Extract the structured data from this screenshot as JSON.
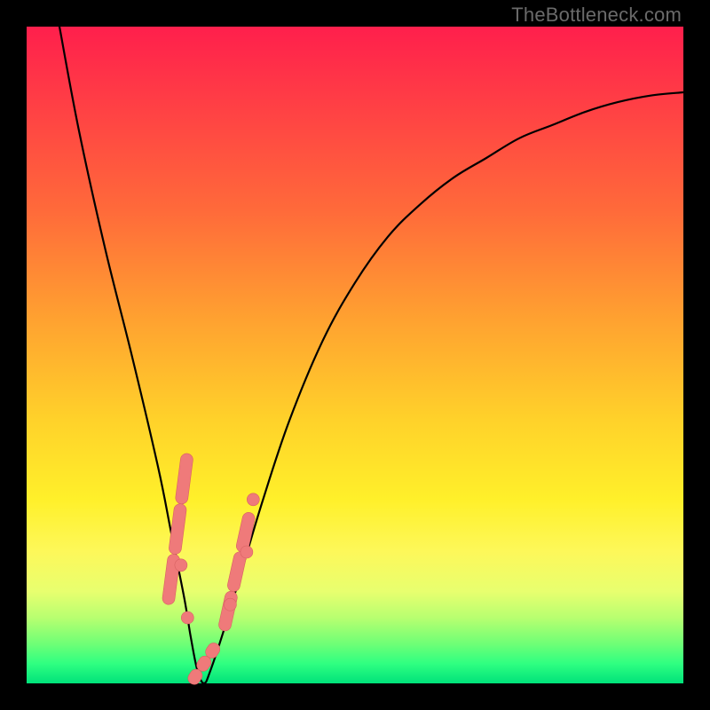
{
  "watermark": "TheBottleneck.com",
  "colors": {
    "frame": "#000000",
    "gradient_top": "#ff1f4c",
    "gradient_mid1": "#ff6a3a",
    "gradient_mid2": "#ffd22a",
    "gradient_mid3": "#fdf85a",
    "gradient_bottom": "#00e27a",
    "curve": "#000000",
    "markers": "#ef7a7a"
  },
  "chart_data": {
    "type": "line",
    "title": "",
    "xlabel": "",
    "ylabel": "",
    "xlim": [
      0,
      100
    ],
    "ylim": [
      0,
      100
    ],
    "grid": false,
    "legend": false,
    "series": [
      {
        "name": "bottleneck-curve",
        "x": [
          5,
          8,
          12,
          16,
          20,
          22,
          24,
          25,
          26,
          27,
          28,
          30,
          33,
          36,
          40,
          45,
          50,
          55,
          60,
          65,
          70,
          75,
          80,
          85,
          90,
          95,
          100
        ],
        "y": [
          100,
          84,
          66,
          50,
          33,
          23,
          13,
          7,
          2,
          0,
          2,
          8,
          18,
          28,
          40,
          52,
          61,
          68,
          73,
          77,
          80,
          83,
          85,
          87,
          88.5,
          89.5,
          90
        ]
      }
    ],
    "markers": [
      {
        "name": "left-cluster",
        "x_range": [
          21.5,
          24.5
        ],
        "y_range": [
          12,
          35
        ],
        "style": "pill"
      },
      {
        "name": "minimum-cluster",
        "x_range": [
          25,
          29
        ],
        "y_range": [
          0,
          6
        ],
        "style": "pill"
      },
      {
        "name": "right-cluster",
        "x_range": [
          30,
          34
        ],
        "y_range": [
          8,
          26
        ],
        "style": "pill"
      },
      {
        "name": "dot-left-a",
        "x": 23.5,
        "y": 18
      },
      {
        "name": "dot-left-b",
        "x": 24.5,
        "y": 10
      },
      {
        "name": "dot-right-a",
        "x": 31,
        "y": 12
      },
      {
        "name": "dot-right-b",
        "x": 33.5,
        "y": 20
      },
      {
        "name": "dot-right-c",
        "x": 34.5,
        "y": 28
      }
    ],
    "notes": "Values estimated from pixel positions; axes are unlabeled in source image so 0-100 normalized scale used."
  }
}
